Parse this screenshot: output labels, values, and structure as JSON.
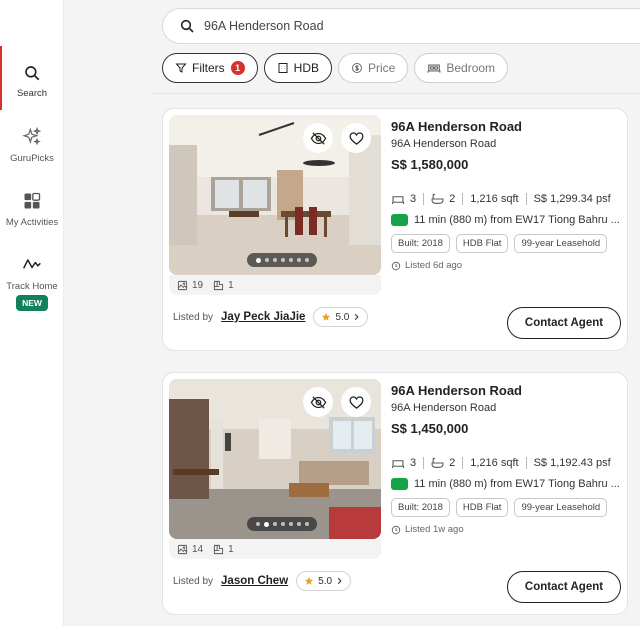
{
  "sidebar": {
    "items": [
      {
        "label": "Search",
        "icon": "search-icon"
      },
      {
        "label": "GuruPicks",
        "icon": "sparkle-icon"
      },
      {
        "label": "My Activities",
        "icon": "activities-icon"
      },
      {
        "label": "Track Home",
        "icon": "trend-icon",
        "badge": "NEW"
      }
    ]
  },
  "search": {
    "query": "96A Henderson Road"
  },
  "filters": {
    "filters_label": "Filters",
    "filters_count": "1",
    "hdb_label": "HDB",
    "price_label": "Price",
    "bedroom_label": "Bedroom"
  },
  "listings": [
    {
      "title": "96A Henderson Road",
      "address": "96A Henderson Road",
      "price": "S$ 1,580,000",
      "beds": "3",
      "baths": "2",
      "area": "1,216 sqft",
      "psf": "S$ 1,299.34 psf",
      "mrt": "11 min (880 m) from EW17 Tiong Bahru ...",
      "tags": [
        "Built: 2018",
        "HDB Flat",
        "99-year Leasehold"
      ],
      "listed": "Listed 6d ago",
      "photos": "19",
      "floorplans": "1",
      "listed_by": "Listed by",
      "agent": "Jay Peck JiaJie",
      "rating": "5.0",
      "contact": "Contact Agent"
    },
    {
      "title": "96A Henderson Road",
      "address": "96A Henderson Road",
      "price": "S$ 1,450,000",
      "beds": "3",
      "baths": "2",
      "area": "1,216 sqft",
      "psf": "S$ 1,192.43 psf",
      "mrt": "11 min (880 m) from EW17 Tiong Bahru ...",
      "tags": [
        "Built: 2018",
        "HDB Flat",
        "99-year Leasehold"
      ],
      "listed": "Listed 1w ago",
      "photos": "14",
      "floorplans": "1",
      "listed_by": "Listed by",
      "agent": "Jason Chew",
      "rating": "5.0",
      "contact": "Contact Agent"
    }
  ],
  "colors": {
    "accent": "#d7312f",
    "mrt_line": "#14a348",
    "new_badge": "#12805c"
  }
}
